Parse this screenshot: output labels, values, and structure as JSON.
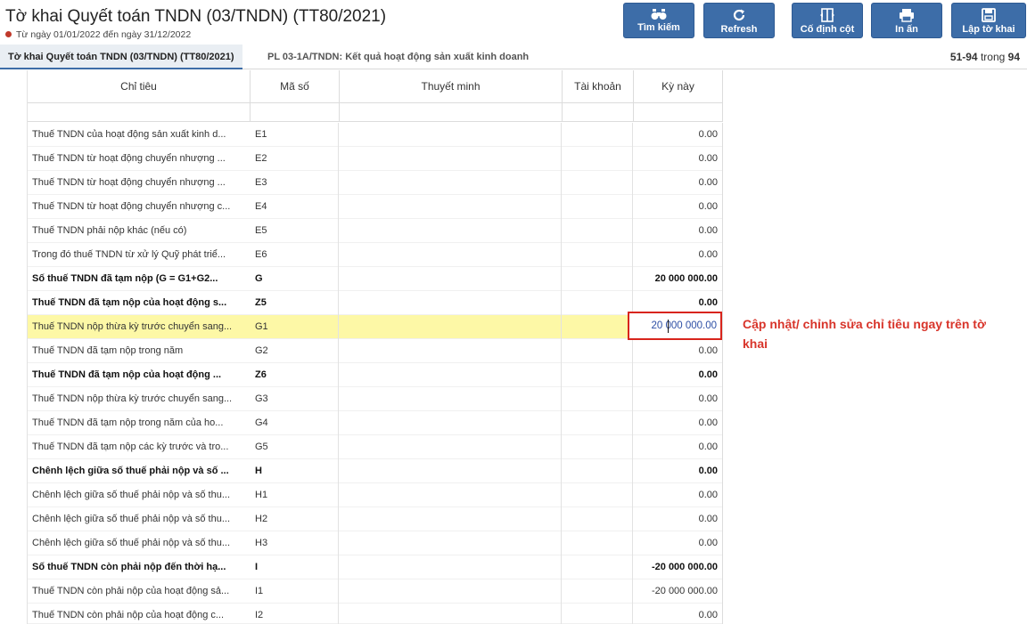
{
  "header": {
    "title": "Tờ khai Quyết toán TNDN (03/TNDN) (TT80/2021)",
    "period": "Từ ngày 01/01/2022 đến ngày 31/12/2022"
  },
  "toolbar": {
    "search": "Tìm kiếm",
    "refresh": "Refresh",
    "freeze": "Cố định cột",
    "print": "In ấn",
    "create": "Lập tờ khai"
  },
  "tabs": {
    "main": "Tờ khai Quyết toán TNDN (03/TNDN) (TT80/2021)",
    "appendix": "PL 03-1A/TNDN: Kết quả hoạt động sản xuất kinh doanh"
  },
  "pager": {
    "range": "51-94",
    "of_label": "trong",
    "total": "94"
  },
  "columns": {
    "chitieu": "Chỉ tiêu",
    "maso": "Mã số",
    "thuyetminh": "Thuyết minh",
    "taikhoan": "Tài khoản",
    "kynay": "Kỳ này"
  },
  "rows": [
    {
      "chitieu": "Thuế TNDN của hoạt động sản xuất kinh d...",
      "maso": "E1",
      "kynay": "0.00"
    },
    {
      "chitieu": "Thuế TNDN từ hoạt động chuyển nhượng ...",
      "maso": "E2",
      "kynay": "0.00"
    },
    {
      "chitieu": "Thuế TNDN từ hoạt động chuyển nhượng ...",
      "maso": "E3",
      "kynay": "0.00"
    },
    {
      "chitieu": "Thuế TNDN từ hoạt động chuyển nhượng c...",
      "maso": "E4",
      "kynay": "0.00"
    },
    {
      "chitieu": "Thuế TNDN phải nộp khác (nếu có)",
      "maso": "E5",
      "kynay": "0.00"
    },
    {
      "chitieu": "Trong đó thuế TNDN từ xử lý Quỹ phát triể...",
      "maso": "E6",
      "kynay": "0.00"
    },
    {
      "chitieu": "Số thuế TNDN đã tạm nộp (G = G1+G2...",
      "maso": "G",
      "kynay": "20 000 000.00"
    },
    {
      "chitieu": "Thuế TNDN đã tạm nộp của hoạt động s...",
      "maso": "Z5",
      "kynay": "0.00"
    },
    {
      "chitieu": "Thuế TNDN nộp thừa kỳ trước chuyển sang...",
      "maso": "G1",
      "kynay": ""
    },
    {
      "chitieu": "Thuế TNDN đã tạm nộp trong năm",
      "maso": "G2",
      "kynay": "0.00"
    },
    {
      "chitieu": "Thuế TNDN đã tạm nộp của hoạt động ...",
      "maso": "Z6",
      "kynay": "0.00"
    },
    {
      "chitieu": "Thuế TNDN nộp thừa kỳ trước chuyển sang...",
      "maso": "G3",
      "kynay": "0.00"
    },
    {
      "chitieu": "Thuế TNDN đã tạm nộp trong năm của ho...",
      "maso": "G4",
      "kynay": "0.00"
    },
    {
      "chitieu": "Thuế TNDN đã tạm nộp các kỳ trước và tro...",
      "maso": "G5",
      "kynay": "0.00"
    },
    {
      "chitieu": "Chênh lệch giữa số thuế phải nộp và số ...",
      "maso": "H",
      "kynay": "0.00"
    },
    {
      "chitieu": "Chênh lệch giữa số thuế phải nộp và số thu...",
      "maso": "H1",
      "kynay": "0.00"
    },
    {
      "chitieu": "Chênh lệch giữa số thuế phải nộp và số thu...",
      "maso": "H2",
      "kynay": "0.00"
    },
    {
      "chitieu": "Chênh lệch giữa số thuế phải nộp và số thu...",
      "maso": "H3",
      "kynay": "0.00"
    },
    {
      "chitieu": "Số thuế TNDN còn phải nộp đến thời hạ...",
      "maso": "I",
      "kynay": "-20 000 000.00"
    },
    {
      "chitieu": "Thuế TNDN còn phải nộp của hoạt động sả...",
      "maso": "I1",
      "kynay": "-20 000 000.00"
    },
    {
      "chitieu": "Thuế TNDN còn phải nộp của hoạt động c...",
      "maso": "I2",
      "kynay": "0.00"
    }
  ],
  "edit_value": "20 000 000.00",
  "annotation": "Cập nhật/ chỉnh sửa chỉ tiêu ngay trên tờ khai"
}
